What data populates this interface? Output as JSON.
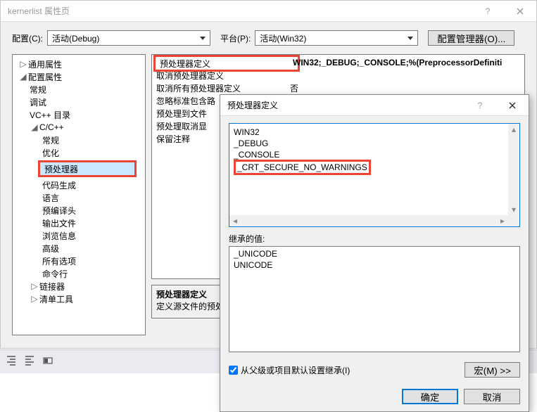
{
  "window_title": "kernerlist 属性页",
  "config_label": "配置(C):",
  "config_value": "活动(Debug)",
  "platform_label": "平台(P):",
  "platform_value": "活动(Win32)",
  "config_manager": "配置管理器(O)...",
  "tree": {
    "general_props": "通用属性",
    "config_props": "配置属性",
    "general": "常规",
    "debug": "调试",
    "vcpp_dirs": "VC++ 目录",
    "ccpp": "C/C++",
    "ccpp_general": "常规",
    "optimize": "优化",
    "preprocessor": "预处理器",
    "codegen": "代码生成",
    "language": "语言",
    "pch": "预编译头",
    "output": "输出文件",
    "browse": "浏览信息",
    "advanced": "高级",
    "options": "所有选项",
    "cmdline": "命令行",
    "linker": "链接器",
    "manifest": "清单工具"
  },
  "prop": {
    "preproc_def_key": "预处理器定义",
    "preproc_def_val": "WIN32;_DEBUG;_CONSOLE;%(PreprocessorDefiniti",
    "undef_key": "取消预处理器定义",
    "undef_all_key": "取消所有预处理器定义",
    "undef_all_val": "否",
    "ignore_std_key": "忽略标准包含路",
    "preproc_to_file_key": "预处理到文件",
    "preproc_suppress_key": "预处理取消显",
    "keep_comments_key": "保留注释"
  },
  "help": {
    "title": "预处理器定义",
    "desc": "定义源文件的预处"
  },
  "dialog": {
    "title": "预处理器定义",
    "lines": [
      "WIN32",
      "_DEBUG",
      "_CONSOLE",
      "_CRT_SECURE_NO_WARNINGS"
    ],
    "inherit_label": "继承的值:",
    "inherited": [
      "_UNICODE",
      "UNICODE"
    ],
    "checkbox": "从父级或项目默认设置继承(I)",
    "macro_btn": "宏(M) >>",
    "ok": "确定",
    "cancel": "取消"
  }
}
